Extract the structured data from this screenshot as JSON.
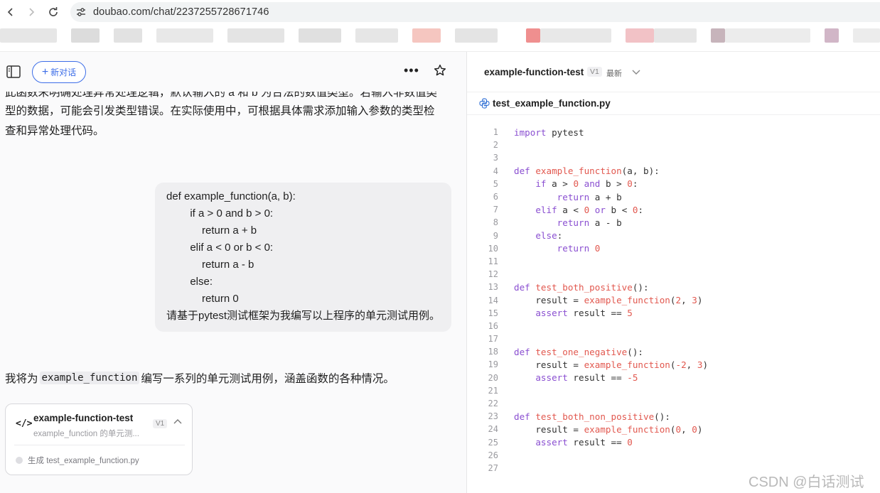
{
  "browser": {
    "url": "doubao.com/chat/2237255728671746"
  },
  "toolbar": {
    "new_chat_label": "新对话"
  },
  "chat": {
    "intro_cut_line": "此函数未明确处理异常处理逻辑，默认输入的 a 和 b 为合法的数值类型。若输入非数值类",
    "intro_lines": [
      "型的数据，可能会引发类型错误。在实际使用中，可根据具体需求添加输入参数的类型检",
      "查和异常处理代码。"
    ],
    "user_message_lines": [
      "def example_function(a, b):",
      "        if a > 0 and b > 0:",
      "            return a + b",
      "        elif a < 0 or b < 0:",
      "            return a - b",
      "        else:",
      "            return 0",
      "请基于pytest测试框架为我编写以上程序的单元测试用例。"
    ],
    "answer_prefix": "我将为",
    "answer_code": "example_function",
    "answer_suffix": "编写一系列的单元测试用例，涵盖函数的各种情况。",
    "card": {
      "title": "example-function-test",
      "subtitle": "example_function 的单元测...",
      "version": "V1",
      "status": "生成 test_example_function.py"
    }
  },
  "artifact": {
    "title": "example-function-test",
    "version": "V1",
    "latest": "最新",
    "file_name": "test_example_function.py"
  },
  "code_lines": [
    "1",
    "2",
    "3",
    "4",
    "5",
    "6",
    "7",
    "8",
    "9",
    "10",
    "11",
    "12",
    "13",
    "14",
    "15",
    "16",
    "17",
    "18",
    "19",
    "20",
    "21",
    "22",
    "23",
    "24",
    "25",
    "26",
    "27"
  ],
  "watermark": "CSDN @白话测试",
  "colors": {
    "accent": "#3d6ee8",
    "keyword": "#8a4fd1",
    "function_name": "#e2584f"
  }
}
